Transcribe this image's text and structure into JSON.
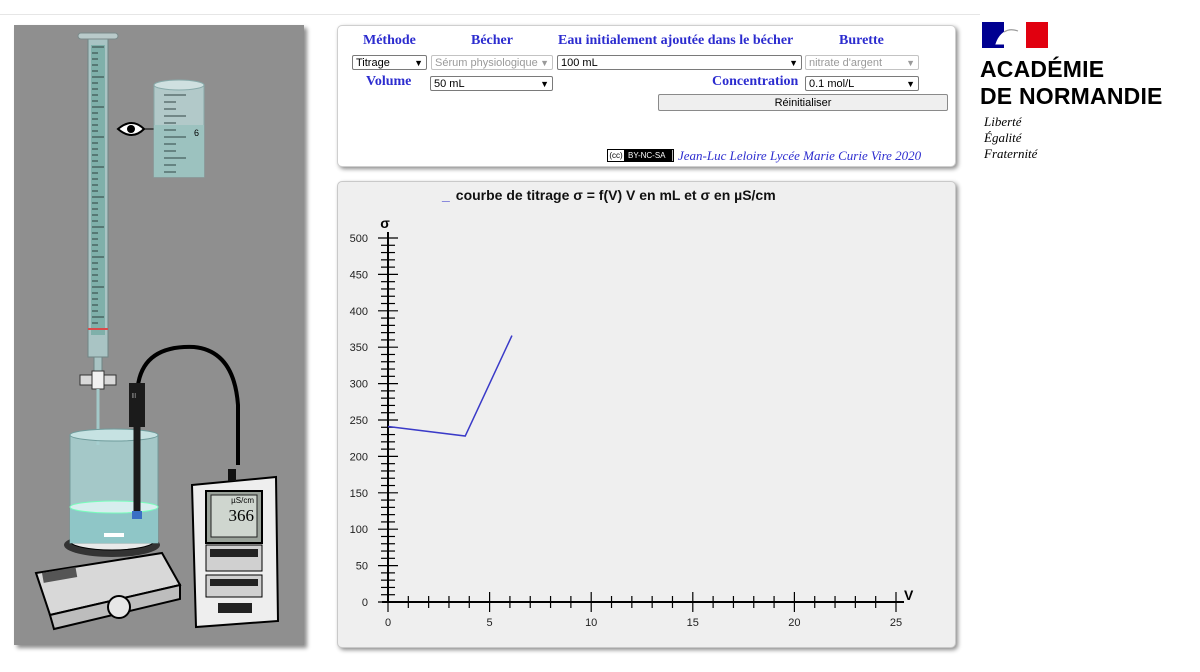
{
  "controls": {
    "method_header": "Méthode",
    "becher_header": "Bécher",
    "water_header": "Eau initialement ajoutée dans le bécher",
    "burette_header": "Burette",
    "volume_label": "Volume",
    "concentration_label": "Concentration",
    "method_value": "Titrage",
    "becher_value": "Sérum physiologique",
    "water_value": "100 mL",
    "burette_value": "nitrate d'argent",
    "volume_value": "50 mL",
    "concentration_value": "0.1 mol/L",
    "reset_label": "Réinitialiser",
    "cc_license": "BY-NC-SA",
    "cc_symbol": "(cc)",
    "credit": "Jean-Luc Leloire Lycée Marie Curie Vire 2020"
  },
  "simulation": {
    "meter_unit": "µS/cm",
    "meter_value": "366",
    "beaker_mark": "6"
  },
  "graph": {
    "title": "courbe de titrage σ = f(V) V en mL et σ en µS/cm",
    "legend_marker": "_"
  },
  "chart_data": {
    "type": "line",
    "title": "courbe de titrage σ = f(V) V en mL et σ en µS/cm",
    "xlabel": "V",
    "ylabel": "σ",
    "xlim": [
      0,
      25
    ],
    "ylim": [
      0,
      500
    ],
    "x_ticks": [
      0,
      5,
      10,
      15,
      20,
      25
    ],
    "y_ticks": [
      0,
      50,
      100,
      150,
      200,
      250,
      300,
      350,
      400,
      450,
      500
    ],
    "series": [
      {
        "x": [
          0,
          3.8,
          6.1
        ],
        "y": [
          241,
          228,
          366
        ]
      }
    ],
    "grid": false,
    "line_color": "#3a3ac8"
  },
  "logo": {
    "line1": "ACADÉMIE",
    "line2": "DE NORMANDIE",
    "motto1": "Liberté",
    "motto2": "Égalité",
    "motto3": "Fraternité"
  }
}
